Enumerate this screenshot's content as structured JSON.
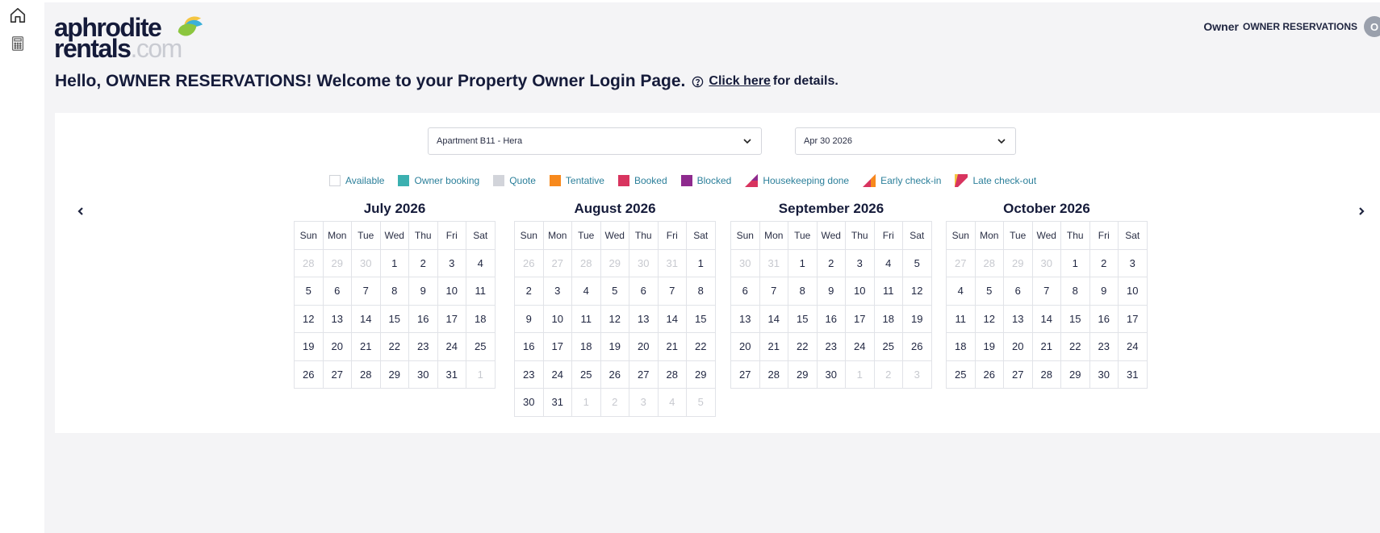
{
  "sidebar": {
    "icons": [
      "home-icon",
      "calculator-icon"
    ]
  },
  "brand": {
    "top": "aphrodite",
    "rentals": "rentals",
    "com": ".com"
  },
  "header": {
    "role": "Owner",
    "name": "OWNER RESERVATIONS",
    "avatar_initial": "O"
  },
  "welcome": {
    "text": "Hello, OWNER RESERVATIONS! Welcome to your Property Owner Login Page.",
    "link": "Click here",
    "suffix": "for details."
  },
  "filters": {
    "property": "Apartment B11 - Hera",
    "date": "Apr 30 2026"
  },
  "legend": [
    {
      "label": "Available",
      "type": "box",
      "color": "#ffffff"
    },
    {
      "label": "Owner booking",
      "type": "box",
      "color": "#3bb0b0"
    },
    {
      "label": "Quote",
      "type": "box",
      "color": "#d2d4da"
    },
    {
      "label": "Tentative",
      "type": "box",
      "color": "#f7891c"
    },
    {
      "label": "Booked",
      "type": "box",
      "color": "#d8345f"
    },
    {
      "label": "Blocked",
      "type": "box",
      "color": "#8e2a8e"
    },
    {
      "label": "Housekeeping done",
      "type": "tri",
      "color": "#d8345f",
      "accent": "#8e2a8e"
    },
    {
      "label": "Early check-in",
      "type": "tri",
      "color": "#d8345f",
      "accent": "#f7891c"
    },
    {
      "label": "Late check-out",
      "type": "tri",
      "color": "#d8345f",
      "accent": "#f4c542"
    }
  ],
  "weekdays": [
    "Sun",
    "Mon",
    "Tue",
    "Wed",
    "Thu",
    "Fri",
    "Sat"
  ],
  "months": [
    {
      "title": "July 2026",
      "weeks": [
        [
          [
            "28",
            1
          ],
          [
            "29",
            1
          ],
          [
            "30",
            1
          ],
          [
            "1",
            0
          ],
          [
            "2",
            0
          ],
          [
            "3",
            0
          ],
          [
            "4",
            0
          ]
        ],
        [
          [
            "5",
            0
          ],
          [
            "6",
            0
          ],
          [
            "7",
            0
          ],
          [
            "8",
            0
          ],
          [
            "9",
            0
          ],
          [
            "10",
            0
          ],
          [
            "11",
            0
          ]
        ],
        [
          [
            "12",
            0
          ],
          [
            "13",
            0
          ],
          [
            "14",
            0
          ],
          [
            "15",
            0
          ],
          [
            "16",
            0
          ],
          [
            "17",
            0
          ],
          [
            "18",
            0
          ]
        ],
        [
          [
            "19",
            0
          ],
          [
            "20",
            0
          ],
          [
            "21",
            0
          ],
          [
            "22",
            0
          ],
          [
            "23",
            0
          ],
          [
            "24",
            0
          ],
          [
            "25",
            0
          ]
        ],
        [
          [
            "26",
            0
          ],
          [
            "27",
            0
          ],
          [
            "28",
            0
          ],
          [
            "29",
            0
          ],
          [
            "30",
            0
          ],
          [
            "31",
            0
          ],
          [
            "1",
            1
          ]
        ]
      ]
    },
    {
      "title": "August 2026",
      "weeks": [
        [
          [
            "26",
            1
          ],
          [
            "27",
            1
          ],
          [
            "28",
            1
          ],
          [
            "29",
            1
          ],
          [
            "30",
            1
          ],
          [
            "31",
            1
          ],
          [
            "1",
            0
          ]
        ],
        [
          [
            "2",
            0
          ],
          [
            "3",
            0
          ],
          [
            "4",
            0
          ],
          [
            "5",
            0
          ],
          [
            "6",
            0
          ],
          [
            "7",
            0
          ],
          [
            "8",
            0
          ]
        ],
        [
          [
            "9",
            0
          ],
          [
            "10",
            0
          ],
          [
            "11",
            0
          ],
          [
            "12",
            0
          ],
          [
            "13",
            0
          ],
          [
            "14",
            0
          ],
          [
            "15",
            0
          ]
        ],
        [
          [
            "16",
            0
          ],
          [
            "17",
            0
          ],
          [
            "18",
            0
          ],
          [
            "19",
            0
          ],
          [
            "20",
            0
          ],
          [
            "21",
            0
          ],
          [
            "22",
            0
          ]
        ],
        [
          [
            "23",
            0
          ],
          [
            "24",
            0
          ],
          [
            "25",
            0
          ],
          [
            "26",
            0
          ],
          [
            "27",
            0
          ],
          [
            "28",
            0
          ],
          [
            "29",
            0
          ]
        ],
        [
          [
            "30",
            0
          ],
          [
            "31",
            0
          ],
          [
            "1",
            1
          ],
          [
            "2",
            1
          ],
          [
            "3",
            1
          ],
          [
            "4",
            1
          ],
          [
            "5",
            1
          ]
        ]
      ]
    },
    {
      "title": "September 2026",
      "weeks": [
        [
          [
            "30",
            1
          ],
          [
            "31",
            1
          ],
          [
            "1",
            0
          ],
          [
            "2",
            0
          ],
          [
            "3",
            0
          ],
          [
            "4",
            0
          ],
          [
            "5",
            0
          ]
        ],
        [
          [
            "6",
            0
          ],
          [
            "7",
            0
          ],
          [
            "8",
            0
          ],
          [
            "9",
            0
          ],
          [
            "10",
            0
          ],
          [
            "11",
            0
          ],
          [
            "12",
            0
          ]
        ],
        [
          [
            "13",
            0
          ],
          [
            "14",
            0
          ],
          [
            "15",
            0
          ],
          [
            "16",
            0
          ],
          [
            "17",
            0
          ],
          [
            "18",
            0
          ],
          [
            "19",
            0
          ]
        ],
        [
          [
            "20",
            0
          ],
          [
            "21",
            0
          ],
          [
            "22",
            0
          ],
          [
            "23",
            0
          ],
          [
            "24",
            0
          ],
          [
            "25",
            0
          ],
          [
            "26",
            0
          ]
        ],
        [
          [
            "27",
            0
          ],
          [
            "28",
            0
          ],
          [
            "29",
            0
          ],
          [
            "30",
            0
          ],
          [
            "1",
            1
          ],
          [
            "2",
            1
          ],
          [
            "3",
            1
          ]
        ]
      ]
    },
    {
      "title": "October 2026",
      "weeks": [
        [
          [
            "27",
            1
          ],
          [
            "28",
            1
          ],
          [
            "29",
            1
          ],
          [
            "30",
            1
          ],
          [
            "1",
            0
          ],
          [
            "2",
            0
          ],
          [
            "3",
            0
          ]
        ],
        [
          [
            "4",
            0
          ],
          [
            "5",
            0
          ],
          [
            "6",
            0
          ],
          [
            "7",
            0
          ],
          [
            "8",
            0
          ],
          [
            "9",
            0
          ],
          [
            "10",
            0
          ]
        ],
        [
          [
            "11",
            0
          ],
          [
            "12",
            0
          ],
          [
            "13",
            0
          ],
          [
            "14",
            0
          ],
          [
            "15",
            0
          ],
          [
            "16",
            0
          ],
          [
            "17",
            0
          ]
        ],
        [
          [
            "18",
            0
          ],
          [
            "19",
            0
          ],
          [
            "20",
            0
          ],
          [
            "21",
            0
          ],
          [
            "22",
            0
          ],
          [
            "23",
            0
          ],
          [
            "24",
            0
          ]
        ],
        [
          [
            "25",
            0
          ],
          [
            "26",
            0
          ],
          [
            "27",
            0
          ],
          [
            "28",
            0
          ],
          [
            "29",
            0
          ],
          [
            "30",
            0
          ],
          [
            "31",
            0
          ]
        ]
      ]
    }
  ]
}
